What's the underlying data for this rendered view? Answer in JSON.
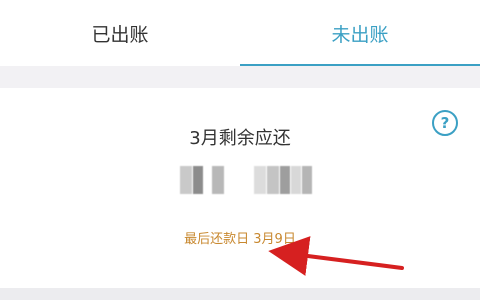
{
  "tabs": [
    {
      "label": "已出账",
      "active": false
    },
    {
      "label": "未出账",
      "active": true
    }
  ],
  "card": {
    "title": "3月剩余应还",
    "amount_redacted": true,
    "due_text": "最后还款日 3月9日"
  },
  "icons": {
    "help": "question-circle-icon",
    "annotation": "red-arrow"
  },
  "colors": {
    "accent": "#3ba0c4",
    "due_text": "#c8882f",
    "arrow": "#d62020",
    "background": "#f2f1f4"
  }
}
